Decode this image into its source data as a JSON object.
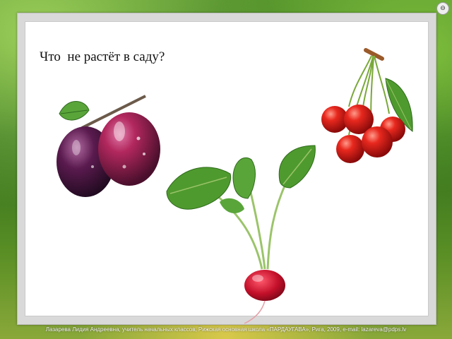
{
  "slide": {
    "question": "Что  не растёт в саду?"
  },
  "images": [
    {
      "name": "plums",
      "icon": "plum-image"
    },
    {
      "name": "radish",
      "icon": "radish-image"
    },
    {
      "name": "cherries",
      "icon": "cherries-image"
    }
  ],
  "footer": {
    "credit": "Лазарева Лидия Андреевна, учитель начальных классов, Рижская основная школа «ПАРДАУГАВА», Рига, 2009, e-mail: lazareva@pdps.lv"
  },
  "colors": {
    "plum": "#7a1f4a",
    "cherry": "#d81e1e",
    "radish": "#c4102a",
    "leaf": "#4f9a2e"
  }
}
